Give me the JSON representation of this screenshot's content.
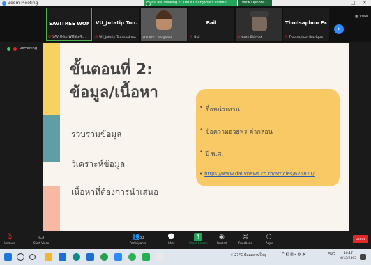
{
  "window": {
    "app_name": "Zoom Meeting",
    "viewing_text": "You are viewing ZOOM's Chargabal's screen",
    "view_options": "View Options",
    "minimize": "–",
    "maximize": "□",
    "close": "✕"
  },
  "strip": {
    "participants": [
      {
        "name": "SAVITREE WON...",
        "label": "SAVITREE WONGPE..."
      },
      {
        "name": "VU_Jutatip Ton...",
        "label": "VU_Jutatip Tonasookme"
      },
      {
        "name": "",
        "label": "ZOOM's Chargabal"
      },
      {
        "name": "Bail",
        "label": "Bail"
      },
      {
        "name": "",
        "label": "พลอย Phichet"
      },
      {
        "name": "Thodsaphon Pr...",
        "label": "Thodsaphon Prachpre..."
      }
    ],
    "next_icon": "›",
    "gallery_label": "View"
  },
  "recording": {
    "label": "Recording"
  },
  "slide": {
    "heading_line1": "ขั้นตอนที่ 2:",
    "heading_line2": "ข้อมูล/เนื้อหา",
    "left_items": [
      "รวบรวมข้อมูล",
      "วิเคราะห์ข้อมูล",
      "เนื้อหาที่ต้องการนำเสนอ"
    ],
    "bullets": [
      "ชื่อหน่วยงาน",
      "ข้อความอวยพร คำกลอน",
      "ปี พ.ศ."
    ],
    "link": "https://www.dailynews.co.th/articles/621871/"
  },
  "toolbar": {
    "unmute": "Unmute",
    "start_video": "Start Video",
    "participants": "Participants",
    "participants_count": "33",
    "chat": "Chat",
    "share_screen": "Share Screen",
    "record": "Record",
    "reactions": "Reactions",
    "apps": "Apps",
    "leave": "Leave"
  },
  "taskbar": {
    "weather": "27°C มีแดดส่วนใหญ่",
    "lang": "ENG",
    "time": "10:17",
    "date": "4/15/2565"
  }
}
